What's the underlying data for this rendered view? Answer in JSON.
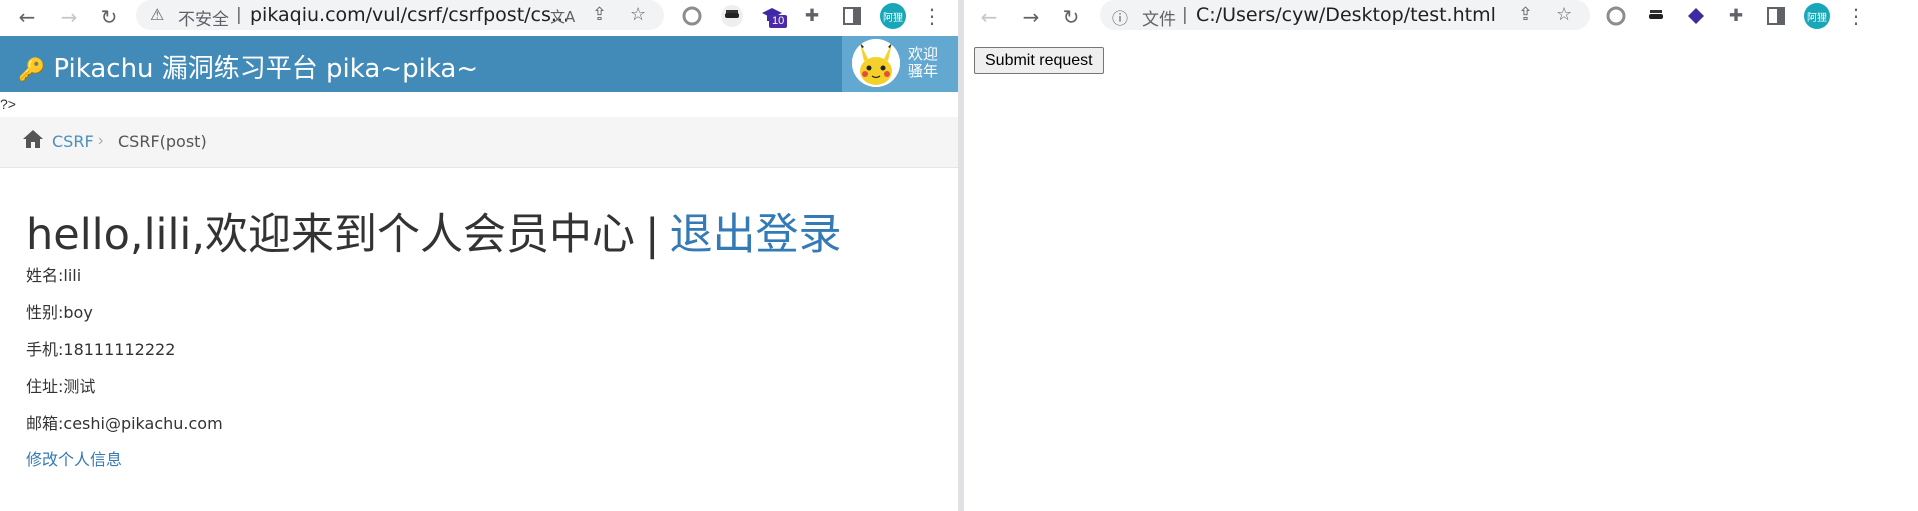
{
  "left_browser": {
    "nav": {
      "back": "←",
      "forward": "→",
      "reload": "↻"
    },
    "omnibox": {
      "warning_icon": "⚠",
      "security_label": "不安全",
      "separator": "|",
      "url": "pikaqiu.com/vul/csrf/csrfpost/cs...",
      "icons": [
        "translate-icon",
        "share-icon",
        "star-icon"
      ]
    },
    "extensions": {
      "badge_count": "10",
      "profile_label": "阿狸"
    }
  },
  "right_browser": {
    "nav": {
      "back": "←",
      "forward": "→",
      "reload": "↻"
    },
    "omnibox": {
      "info_icon": "ⓘ",
      "file_label": "文件",
      "separator": "|",
      "url": "C:/Users/cyw/Desktop/test.html",
      "icons": [
        "share-icon",
        "star-icon"
      ]
    },
    "extensions": {
      "profile_label": "阿狸"
    }
  },
  "site": {
    "title": "Pikachu 漏洞练习平台 pika~pika~",
    "user_greeting_line1": "欢迎",
    "user_greeting_line2": "骚年",
    "stray_text": "?>",
    "breadcrumb": {
      "link": "CSRF",
      "separator": "›",
      "current": "CSRF(post)"
    },
    "welcome_text": "hello,lili,欢迎来到个人会员中心",
    "welcome_separator": "|",
    "logout_link": "退出登录",
    "info": [
      "姓名:lili",
      "性别:boy",
      "手机:18111112222",
      "住址:测试",
      "邮箱:ceshi@pikachu.com"
    ],
    "edit_link": "修改个人信息",
    "header_color": "#428bb8",
    "link_color": "#337ab7"
  },
  "attacker_page": {
    "submit_label": "Submit request"
  }
}
